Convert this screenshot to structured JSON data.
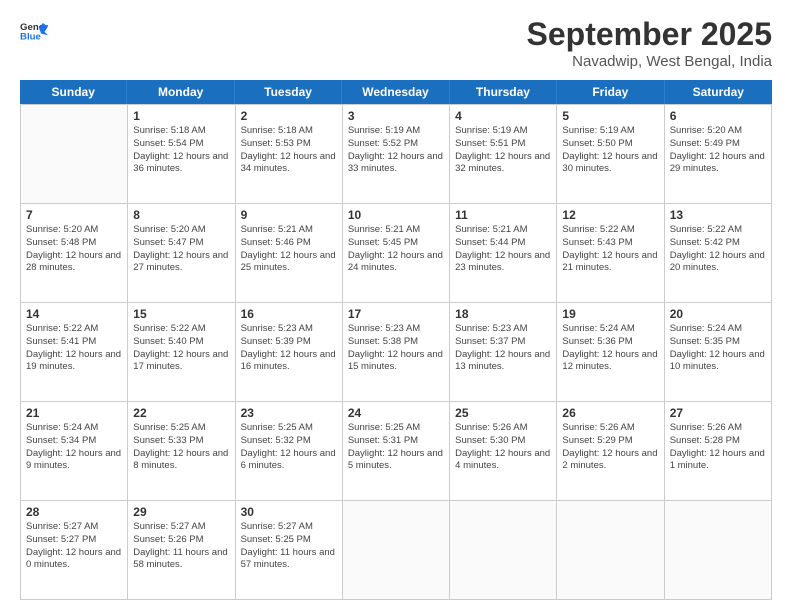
{
  "header": {
    "logo_general": "General",
    "logo_blue": "Blue",
    "month_title": "September 2025",
    "subtitle": "Navadwip, West Bengal, India"
  },
  "weekdays": [
    "Sunday",
    "Monday",
    "Tuesday",
    "Wednesday",
    "Thursday",
    "Friday",
    "Saturday"
  ],
  "weeks": [
    [
      {
        "day": "",
        "sunrise": "",
        "sunset": "",
        "daylight": ""
      },
      {
        "day": "1",
        "sunrise": "Sunrise: 5:18 AM",
        "sunset": "Sunset: 5:54 PM",
        "daylight": "Daylight: 12 hours and 36 minutes."
      },
      {
        "day": "2",
        "sunrise": "Sunrise: 5:18 AM",
        "sunset": "Sunset: 5:53 PM",
        "daylight": "Daylight: 12 hours and 34 minutes."
      },
      {
        "day": "3",
        "sunrise": "Sunrise: 5:19 AM",
        "sunset": "Sunset: 5:52 PM",
        "daylight": "Daylight: 12 hours and 33 minutes."
      },
      {
        "day": "4",
        "sunrise": "Sunrise: 5:19 AM",
        "sunset": "Sunset: 5:51 PM",
        "daylight": "Daylight: 12 hours and 32 minutes."
      },
      {
        "day": "5",
        "sunrise": "Sunrise: 5:19 AM",
        "sunset": "Sunset: 5:50 PM",
        "daylight": "Daylight: 12 hours and 30 minutes."
      },
      {
        "day": "6",
        "sunrise": "Sunrise: 5:20 AM",
        "sunset": "Sunset: 5:49 PM",
        "daylight": "Daylight: 12 hours and 29 minutes."
      }
    ],
    [
      {
        "day": "7",
        "sunrise": "Sunrise: 5:20 AM",
        "sunset": "Sunset: 5:48 PM",
        "daylight": "Daylight: 12 hours and 28 minutes."
      },
      {
        "day": "8",
        "sunrise": "Sunrise: 5:20 AM",
        "sunset": "Sunset: 5:47 PM",
        "daylight": "Daylight: 12 hours and 27 minutes."
      },
      {
        "day": "9",
        "sunrise": "Sunrise: 5:21 AM",
        "sunset": "Sunset: 5:46 PM",
        "daylight": "Daylight: 12 hours and 25 minutes."
      },
      {
        "day": "10",
        "sunrise": "Sunrise: 5:21 AM",
        "sunset": "Sunset: 5:45 PM",
        "daylight": "Daylight: 12 hours and 24 minutes."
      },
      {
        "day": "11",
        "sunrise": "Sunrise: 5:21 AM",
        "sunset": "Sunset: 5:44 PM",
        "daylight": "Daylight: 12 hours and 23 minutes."
      },
      {
        "day": "12",
        "sunrise": "Sunrise: 5:22 AM",
        "sunset": "Sunset: 5:43 PM",
        "daylight": "Daylight: 12 hours and 21 minutes."
      },
      {
        "day": "13",
        "sunrise": "Sunrise: 5:22 AM",
        "sunset": "Sunset: 5:42 PM",
        "daylight": "Daylight: 12 hours and 20 minutes."
      }
    ],
    [
      {
        "day": "14",
        "sunrise": "Sunrise: 5:22 AM",
        "sunset": "Sunset: 5:41 PM",
        "daylight": "Daylight: 12 hours and 19 minutes."
      },
      {
        "day": "15",
        "sunrise": "Sunrise: 5:22 AM",
        "sunset": "Sunset: 5:40 PM",
        "daylight": "Daylight: 12 hours and 17 minutes."
      },
      {
        "day": "16",
        "sunrise": "Sunrise: 5:23 AM",
        "sunset": "Sunset: 5:39 PM",
        "daylight": "Daylight: 12 hours and 16 minutes."
      },
      {
        "day": "17",
        "sunrise": "Sunrise: 5:23 AM",
        "sunset": "Sunset: 5:38 PM",
        "daylight": "Daylight: 12 hours and 15 minutes."
      },
      {
        "day": "18",
        "sunrise": "Sunrise: 5:23 AM",
        "sunset": "Sunset: 5:37 PM",
        "daylight": "Daylight: 12 hours and 13 minutes."
      },
      {
        "day": "19",
        "sunrise": "Sunrise: 5:24 AM",
        "sunset": "Sunset: 5:36 PM",
        "daylight": "Daylight: 12 hours and 12 minutes."
      },
      {
        "day": "20",
        "sunrise": "Sunrise: 5:24 AM",
        "sunset": "Sunset: 5:35 PM",
        "daylight": "Daylight: 12 hours and 10 minutes."
      }
    ],
    [
      {
        "day": "21",
        "sunrise": "Sunrise: 5:24 AM",
        "sunset": "Sunset: 5:34 PM",
        "daylight": "Daylight: 12 hours and 9 minutes."
      },
      {
        "day": "22",
        "sunrise": "Sunrise: 5:25 AM",
        "sunset": "Sunset: 5:33 PM",
        "daylight": "Daylight: 12 hours and 8 minutes."
      },
      {
        "day": "23",
        "sunrise": "Sunrise: 5:25 AM",
        "sunset": "Sunset: 5:32 PM",
        "daylight": "Daylight: 12 hours and 6 minutes."
      },
      {
        "day": "24",
        "sunrise": "Sunrise: 5:25 AM",
        "sunset": "Sunset: 5:31 PM",
        "daylight": "Daylight: 12 hours and 5 minutes."
      },
      {
        "day": "25",
        "sunrise": "Sunrise: 5:26 AM",
        "sunset": "Sunset: 5:30 PM",
        "daylight": "Daylight: 12 hours and 4 minutes."
      },
      {
        "day": "26",
        "sunrise": "Sunrise: 5:26 AM",
        "sunset": "Sunset: 5:29 PM",
        "daylight": "Daylight: 12 hours and 2 minutes."
      },
      {
        "day": "27",
        "sunrise": "Sunrise: 5:26 AM",
        "sunset": "Sunset: 5:28 PM",
        "daylight": "Daylight: 12 hours and 1 minute."
      }
    ],
    [
      {
        "day": "28",
        "sunrise": "Sunrise: 5:27 AM",
        "sunset": "Sunset: 5:27 PM",
        "daylight": "Daylight: 12 hours and 0 minutes."
      },
      {
        "day": "29",
        "sunrise": "Sunrise: 5:27 AM",
        "sunset": "Sunset: 5:26 PM",
        "daylight": "Daylight: 11 hours and 58 minutes."
      },
      {
        "day": "30",
        "sunrise": "Sunrise: 5:27 AM",
        "sunset": "Sunset: 5:25 PM",
        "daylight": "Daylight: 11 hours and 57 minutes."
      },
      {
        "day": "",
        "sunrise": "",
        "sunset": "",
        "daylight": ""
      },
      {
        "day": "",
        "sunrise": "",
        "sunset": "",
        "daylight": ""
      },
      {
        "day": "",
        "sunrise": "",
        "sunset": "",
        "daylight": ""
      },
      {
        "day": "",
        "sunrise": "",
        "sunset": "",
        "daylight": ""
      }
    ]
  ]
}
